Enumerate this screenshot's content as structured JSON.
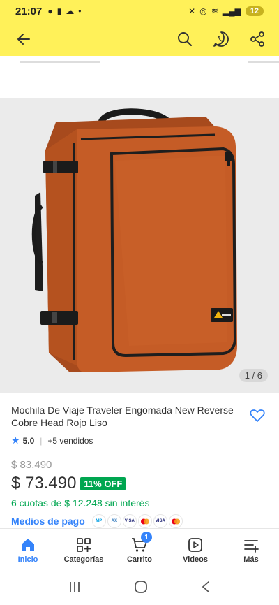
{
  "status_bar": {
    "time": "21:07",
    "battery": "12"
  },
  "gallery": {
    "counter": "1 / 6"
  },
  "product": {
    "title": "Mochila De Viaje Traveler Engomada New Reverse Cobre Head Rojo Liso",
    "rating": "5.0",
    "sold": "+5 vendidos",
    "old_price": "$ 83.490",
    "price": "$ 73.490",
    "discount": "11% OFF",
    "installments": "6 cuotas de $ 12.248 sin interés",
    "payment_link": "Medios de pago",
    "payment_methods": [
      "Mercado Pago",
      "Amex",
      "VISA",
      "Mastercard",
      "Visa Débito",
      "Mastercard Débito"
    ]
  },
  "bottom_nav": {
    "items": [
      {
        "label": "Inicio",
        "icon": "home-icon",
        "active": true
      },
      {
        "label": "Categorías",
        "icon": "categories-icon"
      },
      {
        "label": "Carrito",
        "icon": "cart-icon",
        "badge": "1"
      },
      {
        "label": "Videos",
        "icon": "video-icon"
      },
      {
        "label": "Más",
        "icon": "more-icon"
      }
    ]
  },
  "colors": {
    "header": "#fff159",
    "accent": "#3483fa",
    "success": "#00a650",
    "backpack": "#c25a26"
  }
}
